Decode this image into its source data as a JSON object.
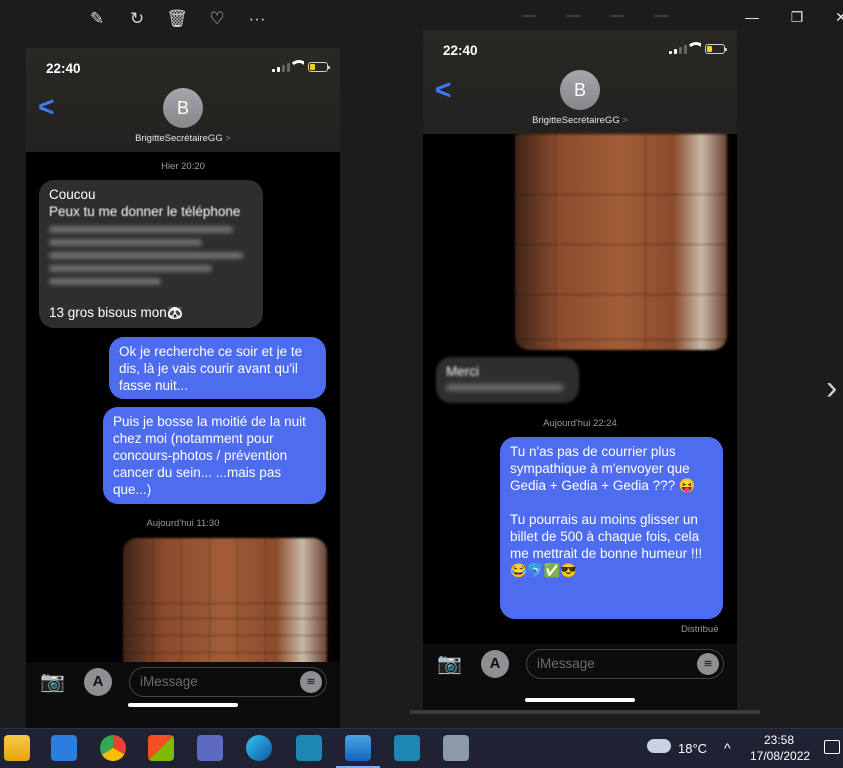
{
  "toolbar": {
    "icons": [
      "edit-icon",
      "rotate-icon",
      "delete-icon",
      "favorite-icon",
      "more-icon"
    ],
    "edit": "✎",
    "rotate": "↻",
    "delete": "🗑",
    "favorite": "♡",
    "more": "···"
  },
  "window_controls": {
    "minimize": "—",
    "restore": "❐",
    "close": "✕"
  },
  "nav_next": "›",
  "left_phone": {
    "time": "22:40",
    "contact_initial": "B",
    "contact_name": "BrigitteSecrétaireGG",
    "contact_chevron": ">",
    "back": "<",
    "timestamp1": "Hier 20:20",
    "incoming": {
      "line1": "Coucou",
      "line2": "Peux tu me donner le téléphone",
      "last_line": "13 gros bisous mon🐼"
    },
    "outgoing1": "Ok je recherche ce soir et je te dis, là je vais courir avant qu'il fasse nuit...",
    "outgoing2": "Puis je bosse la moitié de la nuit chez moi (notamment pour concours-photos / prévention cancer du sein... ...mais pas que...)",
    "timestamp2": "Aujourd'hui 11:30",
    "input_placeholder": "iMessage"
  },
  "right_phone": {
    "time": "22:40",
    "contact_initial": "B",
    "contact_name": "BrigitteSecrétaireGG",
    "contact_chevron": ">",
    "back": "<",
    "incoming_blurred": "Merci",
    "timestamp": "Aujourd'hui 22:24",
    "outgoing_p1": "Tu n'as pas de courrier plus sympathique  à m'envoyer  que Gedia + Gedia + Gedia ??? 😝",
    "outgoing_p2": "Tu pourrais au moins glisser un billet de 500 à chaque fois, cela me mettrait de bonne humeur !!! 😂🐬✅😎",
    "delivered": "Distribué",
    "input_placeholder": "iMessage"
  },
  "taskbar": {
    "apps": [
      "file-explorer",
      "mail",
      "chrome",
      "microsoft-store",
      "remote-desktop",
      "edge",
      "app-blue",
      "photos",
      "app-blue-2",
      "installer"
    ],
    "temperature": "18°C",
    "time": "23:58",
    "date": "17/08/2022",
    "chevron": "^"
  },
  "colors": {
    "bubble_out": "#4e6cf0",
    "bubble_in": "#2e2e30",
    "accent": "#3b7cff",
    "battery": "#f5d21e"
  }
}
